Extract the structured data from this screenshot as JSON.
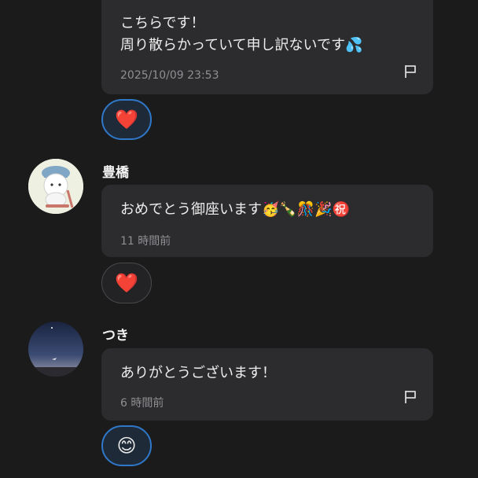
{
  "messages": [
    {
      "text": "こちらです！\n周り散らかっていて申し訳ないです💦",
      "time": "2025/10/09 23:53",
      "reaction": "❤️"
    },
    {
      "user": "豊橋",
      "text": "おめでとう御座います🥳🍾🎊🎉㊗️",
      "time": "11 時間前",
      "reaction": "❤️"
    },
    {
      "user": "つき",
      "text": "ありがとうございます！",
      "time": "6 時間前",
      "reaction": "😊"
    }
  ],
  "icons": {
    "flag": "flag-icon",
    "avatar_toyohashi": "illustrated-avatar",
    "avatar_tsuki": "night-sky-avatar"
  },
  "colors": {
    "background": "#1b1b1c",
    "bubble": "#2c2c2e",
    "reaction_accent": "#2f78c9"
  }
}
